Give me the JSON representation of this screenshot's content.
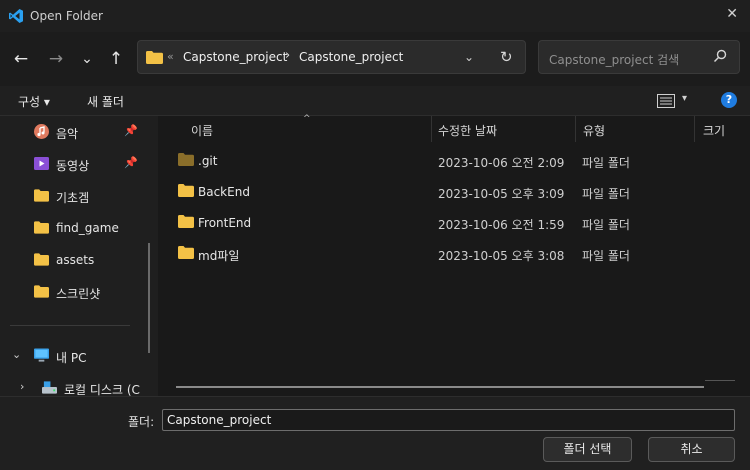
{
  "window": {
    "title": "Open Folder",
    "close": "✕"
  },
  "nav": {
    "back": "←",
    "forward": "→",
    "recent": "⌄",
    "up": "↑",
    "address": {
      "chevron": "«",
      "crumbs": [
        "Capstone_project",
        "Capstone_project"
      ],
      "separator": "›",
      "dropdown": "⌄",
      "refresh": "↻"
    },
    "search_placeholder": "Capstone_project 검색"
  },
  "commands": {
    "organize": "구성 ▾",
    "new_folder": "새 폴더",
    "view_dropdown": "▾",
    "help": "?"
  },
  "sidebar": {
    "items": [
      {
        "label": "음악",
        "icon": "music-icon",
        "pinned": true
      },
      {
        "label": "동영상",
        "icon": "video-icon",
        "pinned": true
      },
      {
        "label": "기초겜",
        "icon": "folder-icon"
      },
      {
        "label": "find_game",
        "icon": "folder-icon"
      },
      {
        "label": "assets",
        "icon": "folder-icon"
      },
      {
        "label": "스크린샷",
        "icon": "folder-icon"
      }
    ],
    "pc": {
      "label": "내 PC",
      "expander": "⌄"
    },
    "disk": {
      "label": "로컬 디스크 (C",
      "expander": "›"
    },
    "pin_glyph": "📌"
  },
  "columns": {
    "name": "이름",
    "modified": "수정한 날짜",
    "type": "유형",
    "size": "크기",
    "sort_glyph": "^"
  },
  "files": [
    {
      "name": ".git",
      "modified": "2023-10-06 오전 2:09",
      "type": "파일 폴더",
      "dim": true
    },
    {
      "name": "BackEnd",
      "modified": "2023-10-05 오후 3:09",
      "type": "파일 폴더"
    },
    {
      "name": "FrontEnd",
      "modified": "2023-10-06 오전 1:59",
      "type": "파일 폴더"
    },
    {
      "name": "md파일",
      "modified": "2023-10-05 오후 3:08",
      "type": "파일 폴더"
    }
  ],
  "footer": {
    "folder_label": "폴더:",
    "folder_value": "Capstone_project",
    "select_button": "폴더 선택",
    "cancel_button": "취소"
  },
  "colors": {
    "accent": "#1f7ce0",
    "folder": "#f3c146",
    "folder_dim": "#8a6e2a"
  }
}
